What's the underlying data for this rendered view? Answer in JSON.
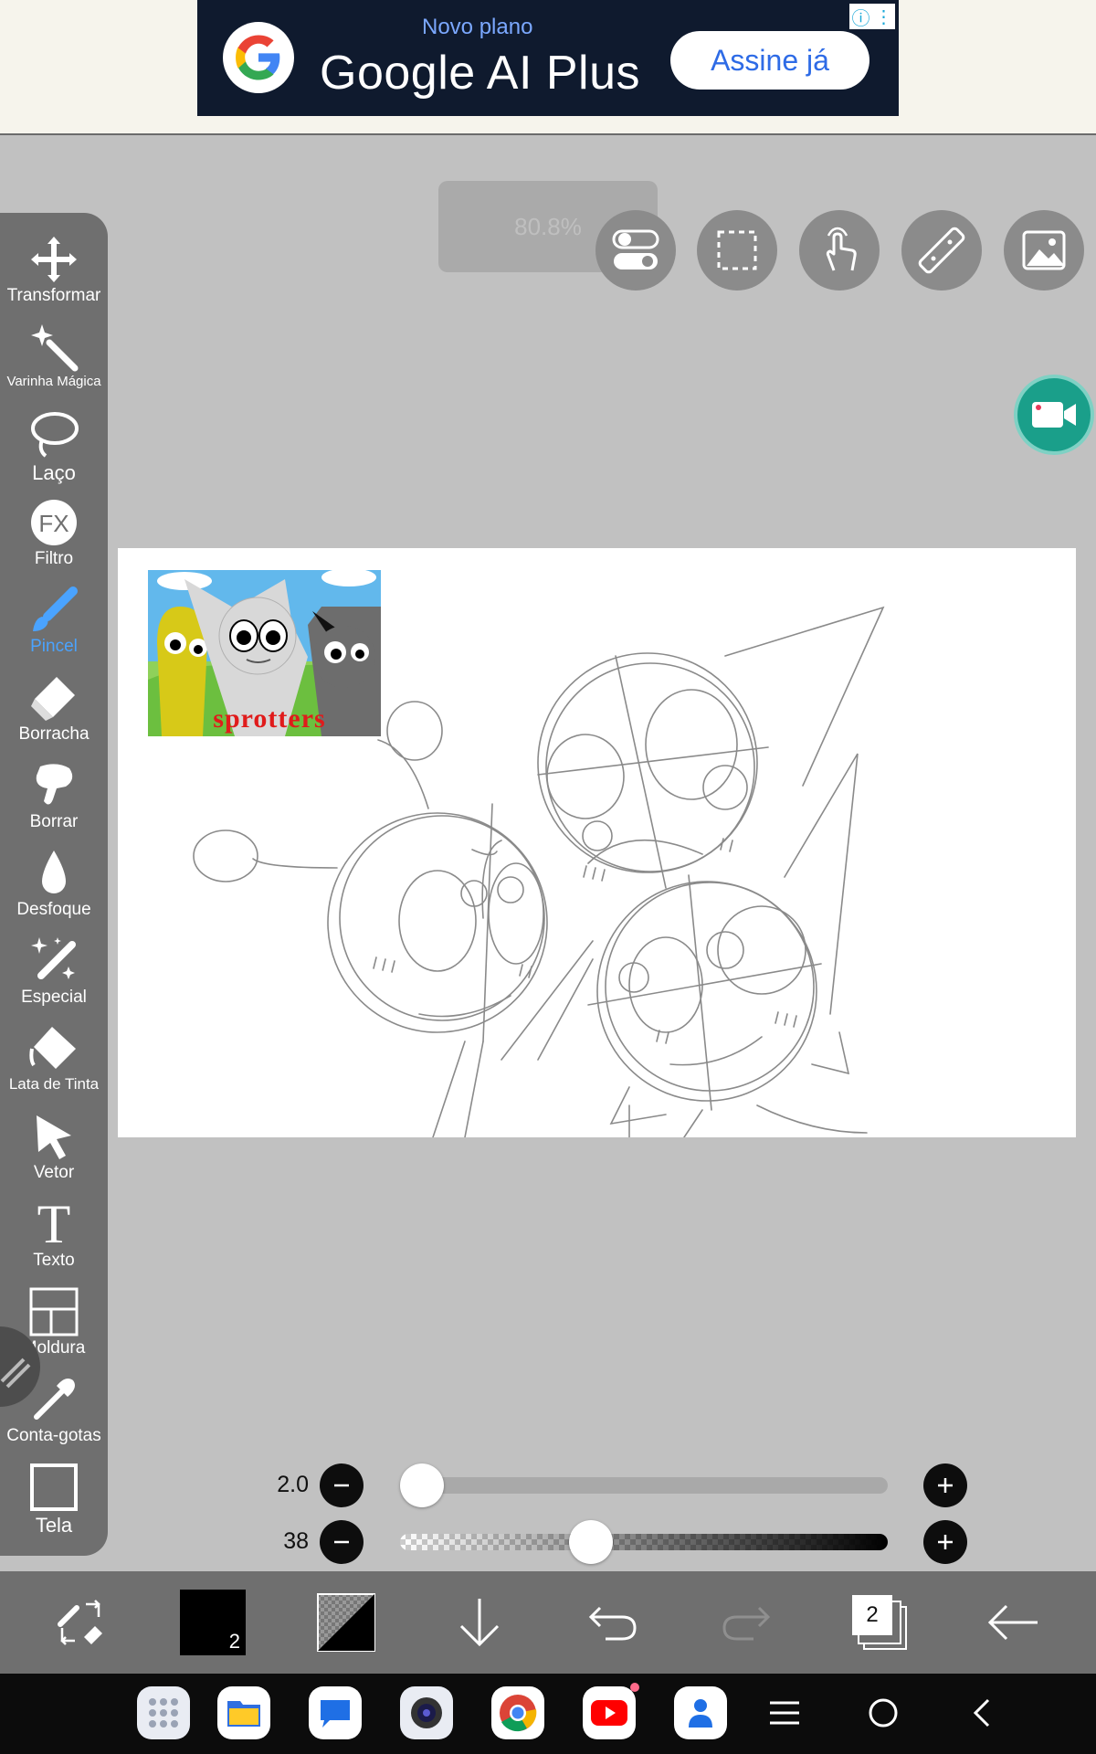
{
  "ad": {
    "small_text": "Novo plano",
    "title": "Google AI Plus",
    "cta": "Assine já",
    "info_icon": "info-icon",
    "menu_icon": "more-vert-icon"
  },
  "zoom": {
    "label": "80.8%"
  },
  "top_tools": [
    "toggle-icon",
    "selection-icon",
    "touch-icon",
    "ruler-icon",
    "image-icon"
  ],
  "left_tools": [
    {
      "label": "Transformar",
      "icon": "move-icon"
    },
    {
      "label": "Varinha Mágica",
      "icon": "magic-wand-icon"
    },
    {
      "label": "Laço",
      "icon": "lasso-icon"
    },
    {
      "label": "Filtro",
      "icon": "fx-icon",
      "icon_text": "FX"
    },
    {
      "label": "Pincel",
      "icon": "brush-icon",
      "active": true
    },
    {
      "label": "Borracha",
      "icon": "eraser-icon"
    },
    {
      "label": "Borrar",
      "icon": "smudge-icon"
    },
    {
      "label": "Desfoque",
      "icon": "blur-icon"
    },
    {
      "label": "Especial",
      "icon": "special-brush-icon"
    },
    {
      "label": "Lata de Tinta",
      "icon": "bucket-icon"
    },
    {
      "label": "Vetor",
      "icon": "vector-icon"
    },
    {
      "label": "Texto",
      "icon": "text-icon",
      "icon_text": "T"
    },
    {
      "label": "Moldura",
      "icon": "frame-icon"
    },
    {
      "label": "Conta-gotas",
      "icon": "eyedropper-icon"
    },
    {
      "label": "Tela",
      "icon": "canvas-icon"
    }
  ],
  "reference_image": {
    "caption": "sprotters"
  },
  "brush_size": {
    "value": "2.0",
    "level": 0.0
  },
  "opacity": {
    "value": "38",
    "level": 0.38
  },
  "bottom_bar": {
    "color_layer_badge": "2",
    "layers_count": "2"
  },
  "colors": {
    "accent": "#4aa3ff",
    "toolbar": "#6f6f6f",
    "record": "#1a9f8a",
    "sprotters_red": "#e01b1b"
  }
}
